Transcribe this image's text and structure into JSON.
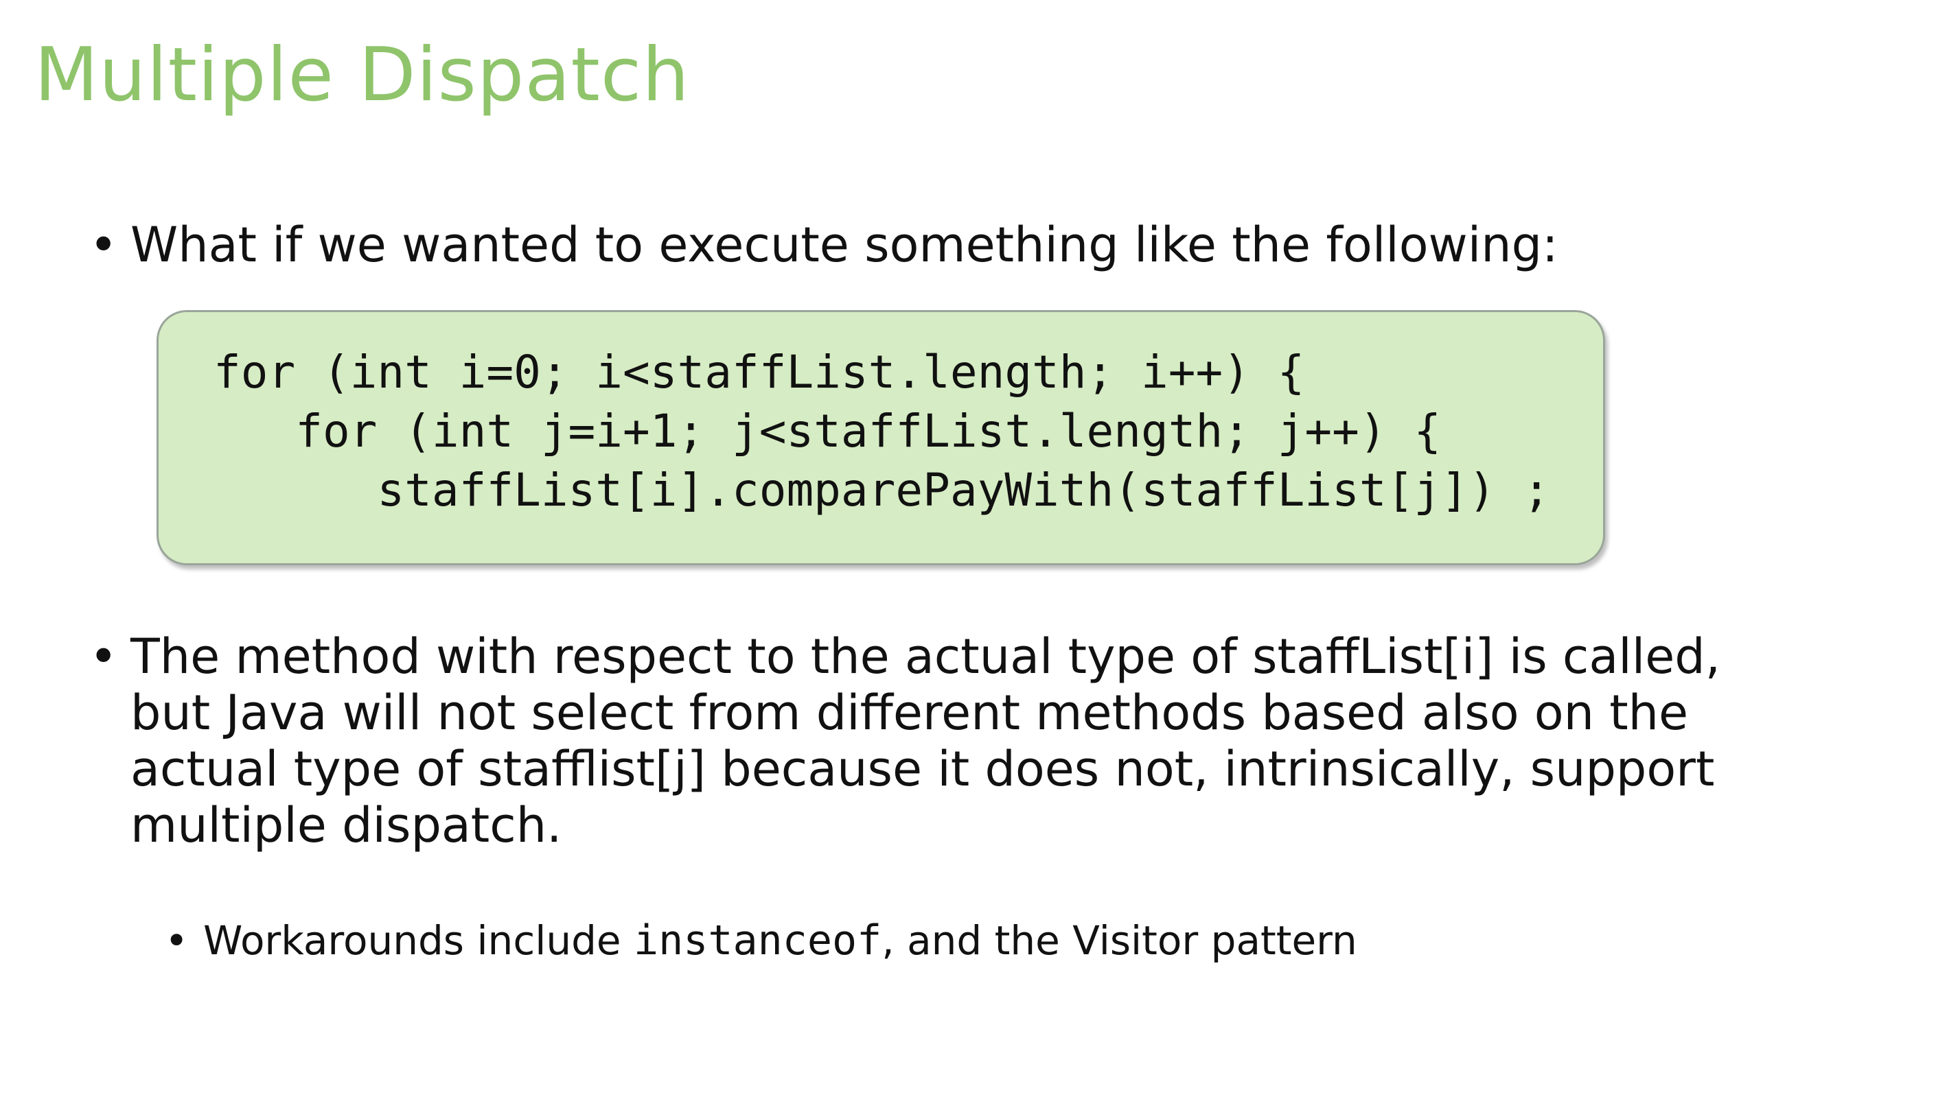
{
  "slide": {
    "title": "Multiple Dispatch",
    "bullets": [
      {
        "marker": "•",
        "text": "What if we wanted to execute something like the following:"
      },
      {
        "marker": "•",
        "lines": [
          "The method with respect to the actual type of staffList[i] is called,",
          "but Java will not select from different methods based also on the",
          "actual type of stafflist[j] because it does not, intrinsically, support",
          "multiple dispatch."
        ]
      }
    ],
    "code_block": {
      "lines": [
        "for (int i=0; i<staffList.length; i++) {",
        "   for (int j=i+1; j<staffList.length; j++) {",
        "      staffList[i].comparePayWith(staffList[j]) ;"
      ],
      "background": "#d6ecc4"
    },
    "sub_bullet": {
      "marker": "•",
      "prefix": "Workarounds include ",
      "code": "instanceof",
      "suffix": ", and the Visitor pattern"
    },
    "colors": {
      "title": "#8fc46b",
      "text": "#111111"
    }
  }
}
